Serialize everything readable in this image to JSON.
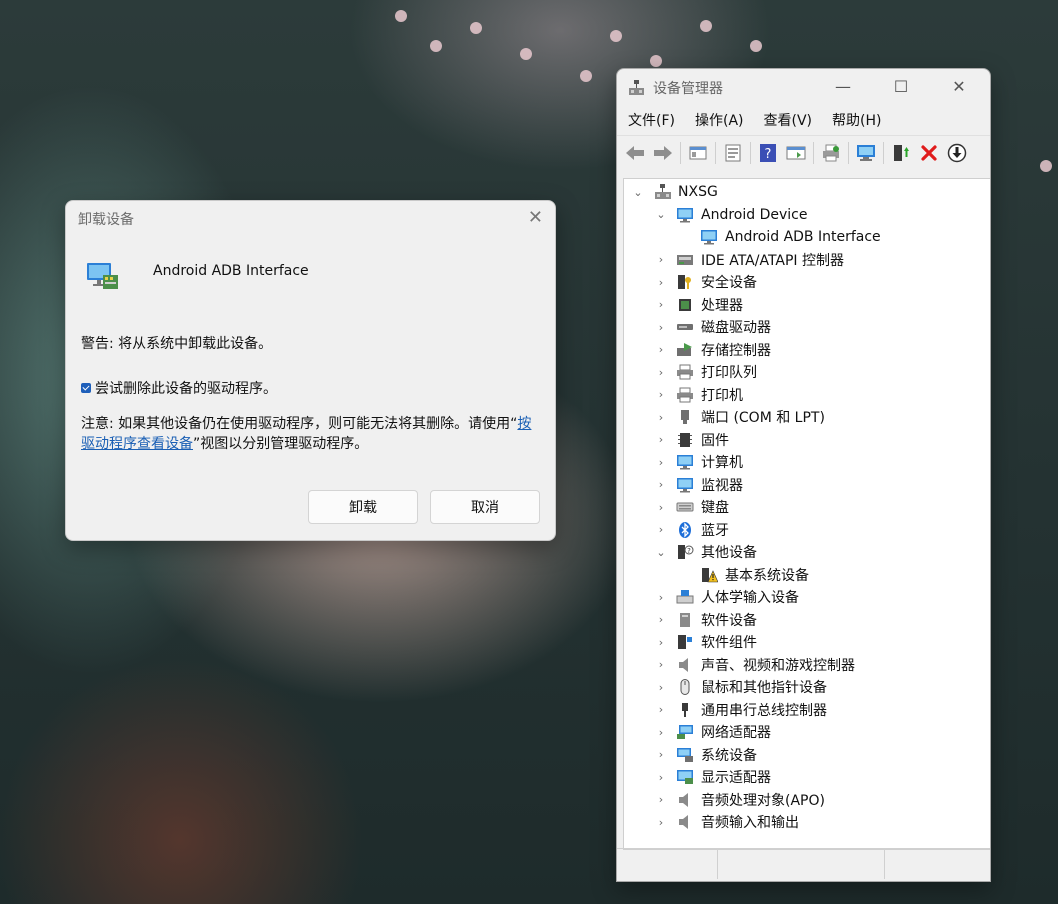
{
  "dialog": {
    "title": "卸载设备",
    "device_name": "Android ADB Interface",
    "warning": "警告: 将从系统中卸载此设备。",
    "checkbox_label": "尝试删除此设备的驱动程序。",
    "checkbox_checked": true,
    "note_prefix": "注意: 如果其他设备仍在使用驱动程序，则可能无法将其删除。请使用“",
    "note_link": "按驱动程序查看设备",
    "note_suffix": "”视图以分别管理驱动程序。",
    "uninstall_button": "卸载",
    "cancel_button": "取消"
  },
  "device_manager": {
    "title": "设备管理器",
    "menu": [
      "文件(F)",
      "操作(A)",
      "查看(V)",
      "帮助(H)"
    ],
    "toolbar": [
      "back-icon",
      "forward-icon",
      "show-hide-icon",
      "properties-icon",
      "help-icon",
      "view-icon",
      "print-icon",
      "scan-hardware-icon",
      "update-driver-icon",
      "uninstall-icon",
      "download-icon"
    ],
    "tree": [
      {
        "label": "NXSG",
        "level": 0,
        "expanded": true,
        "icon": "computer-icon"
      },
      {
        "label": "Android Device",
        "level": 1,
        "expanded": true,
        "icon": "monitor-icon"
      },
      {
        "label": "Android ADB Interface",
        "level": 2,
        "icon": "monitor-icon"
      },
      {
        "label": "IDE ATA/ATAPI 控制器",
        "level": 1,
        "icon": "ide-icon"
      },
      {
        "label": "安全设备",
        "level": 1,
        "icon": "security-icon"
      },
      {
        "label": "处理器",
        "level": 1,
        "icon": "cpu-icon"
      },
      {
        "label": "磁盘驱动器",
        "level": 1,
        "icon": "disk-icon"
      },
      {
        "label": "存储控制器",
        "level": 1,
        "icon": "storage-icon"
      },
      {
        "label": "打印队列",
        "level": 1,
        "icon": "printer-icon"
      },
      {
        "label": "打印机",
        "level": 1,
        "icon": "printer-icon"
      },
      {
        "label": "端口 (COM 和 LPT)",
        "level": 1,
        "icon": "port-icon"
      },
      {
        "label": "固件",
        "level": 1,
        "icon": "firmware-icon"
      },
      {
        "label": "计算机",
        "level": 1,
        "icon": "monitor-icon"
      },
      {
        "label": "监视器",
        "level": 1,
        "icon": "monitor-icon"
      },
      {
        "label": "键盘",
        "level": 1,
        "icon": "keyboard-icon"
      },
      {
        "label": "蓝牙",
        "level": 1,
        "icon": "bluetooth-icon"
      },
      {
        "label": "其他设备",
        "level": 1,
        "expanded": true,
        "icon": "unknown-device-icon"
      },
      {
        "label": "基本系统设备",
        "level": 2,
        "icon": "warning-device-icon"
      },
      {
        "label": "人体学输入设备",
        "level": 1,
        "icon": "hid-icon"
      },
      {
        "label": "软件设备",
        "level": 1,
        "icon": "software-icon"
      },
      {
        "label": "软件组件",
        "level": 1,
        "icon": "component-icon"
      },
      {
        "label": "声音、视频和游戏控制器",
        "level": 1,
        "icon": "speaker-icon"
      },
      {
        "label": "鼠标和其他指针设备",
        "level": 1,
        "icon": "mouse-icon"
      },
      {
        "label": "通用串行总线控制器",
        "level": 1,
        "icon": "usb-icon"
      },
      {
        "label": "网络适配器",
        "level": 1,
        "icon": "network-icon"
      },
      {
        "label": "系统设备",
        "level": 1,
        "icon": "system-icon"
      },
      {
        "label": "显示适配器",
        "level": 1,
        "icon": "display-icon"
      },
      {
        "label": "音频处理对象(APO)",
        "level": 1,
        "icon": "speaker-icon"
      },
      {
        "label": "音频输入和输出",
        "level": 1,
        "icon": "speaker-icon"
      }
    ]
  },
  "colors": {
    "link": "#1a5fb4",
    "checkbox": "#1e5fba",
    "uninstall_x": "#e01b1b"
  }
}
